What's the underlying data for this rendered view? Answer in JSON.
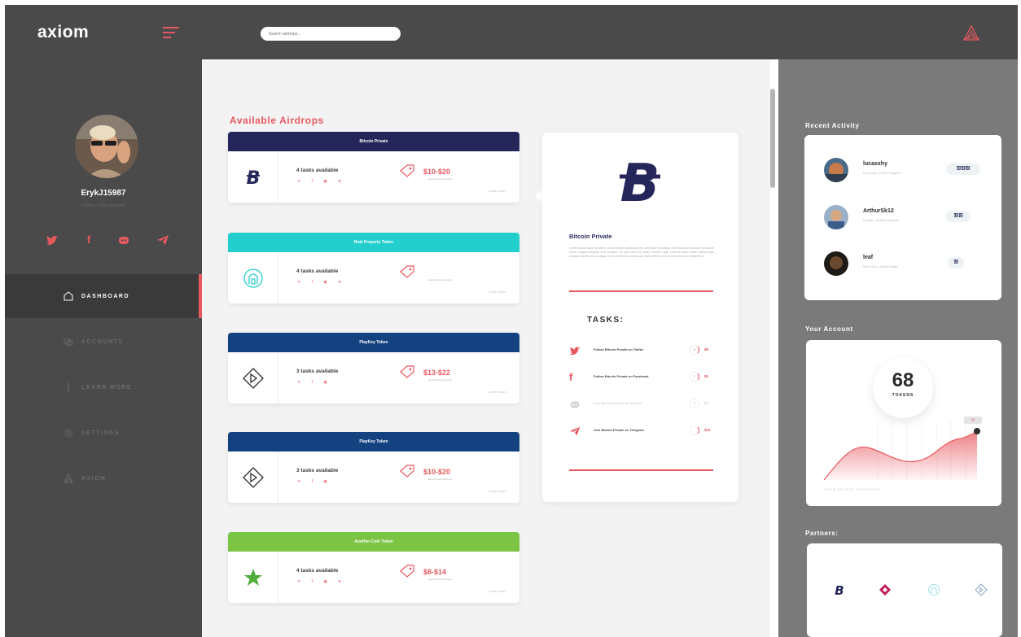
{
  "app": {
    "logo": "axiom"
  },
  "search": {
    "placeholder": "Search airdrops..."
  },
  "profile": {
    "username": "ErykJ15987",
    "location": "London, United Kingdom"
  },
  "nav": {
    "dashboard": "DASHBOARD",
    "accounts": "ACCOUNTS",
    "learn_more": "LEARN MORE",
    "settings": "SETTINGS",
    "axiom": "AXIOM"
  },
  "airdrops": {
    "title": "Available Airdrops",
    "cards": [
      {
        "name": "Bitcoin Private",
        "tasks": "4 tasks available",
        "reward": "$10-$20",
        "reward_sub": "approximate earnings",
        "learn": "Learn more...",
        "header_color": "#25275a"
      },
      {
        "name": "Real Property Token",
        "tasks": "4 tasks available",
        "reward": "",
        "reward_sub": "approximate earnings",
        "learn": "Learn more...",
        "header_color": "#22cfcc"
      },
      {
        "name": "PlayKey Token",
        "tasks": "3 tasks available",
        "reward": "$13-$22",
        "reward_sub": "approximate earnings",
        "learn": "Learn more...",
        "header_color": "#14417f"
      },
      {
        "name": "PlayKey Token",
        "tasks": "3 tasks available",
        "reward": "$10-$20",
        "reward_sub": "approximate earnings",
        "learn": "Learn more...",
        "header_color": "#14417f"
      },
      {
        "name": "Another Coin Token",
        "tasks": "4 tasks available",
        "reward": "$8-$14",
        "reward_sub": "approximate earnings",
        "learn": "Learn more...",
        "header_color": "#7cc444"
      }
    ]
  },
  "details": {
    "title": "Bitcoin Private",
    "description": "Lorem ipsum dolor sit amet, consectetuer adipiscing elit, sed diam nonummy nibh euismod tincidunt ut laoreet dolore magna aliquam erat volutpat. Ut wisi enim ad minim veniam, quis nostrud exerci tation ullamcorper suscipit lobortis nisl ut aliquip ex ea commodo consequat. Duis autem vel eum iriure dolor in hendrerit in",
    "tasks_heading": "TASKS:",
    "tasks": [
      {
        "text": "Follow Bitcoin Private on Twitter",
        "amount": "$8",
        "ring": "3"
      },
      {
        "text": "Follow Bitcoin Private on Facebook",
        "amount": "$5",
        "ring": "2"
      },
      {
        "text": "Join Bitcoin Private on Discord",
        "amount": "$3",
        "ring": "1"
      },
      {
        "text": "Join Bitcoin Private on Telegram",
        "amount": "$10",
        "ring": ""
      }
    ]
  },
  "activity": {
    "title": "Recent Activity",
    "items": [
      {
        "name": "lucasxhy",
        "location": "Liverpool, United Kingdom",
        "badge": "ƁƁƁ"
      },
      {
        "name": "ArthurSk12",
        "location": "London, United Kingdom",
        "badge": "ƁƁ"
      },
      {
        "name": "leaf",
        "location": "New York, United States",
        "badge": "Ɓ"
      }
    ]
  },
  "account": {
    "title": "Your Account",
    "tokens": "68",
    "tokens_label": "TOKENS",
    "marker": "68",
    "progress_label": "YOUR RECENT PROGRESS"
  },
  "partners": {
    "title": "Partners:"
  },
  "colors": {
    "accent": "#e8585f",
    "navy": "#25275a",
    "dark": "#4a4a4a"
  }
}
